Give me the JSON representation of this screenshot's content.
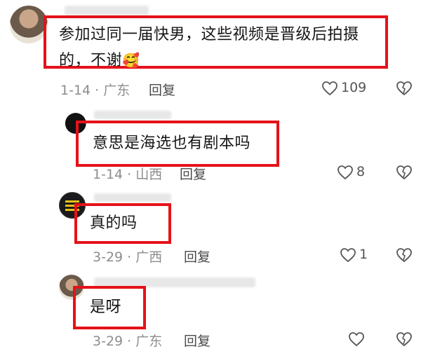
{
  "comments": [
    {
      "text_line1": "参加过同一届快男，这些视频是晋级后拍摄",
      "text_line2": "的，不谢",
      "emoji": "🥰",
      "meta": "1-14 · 广东",
      "reply_label": "回复",
      "like_count": "109"
    },
    {
      "text": "意思是海选也有剧本吗",
      "meta": "1-14 · 山西",
      "reply_label": "回复",
      "like_count": "8"
    },
    {
      "text": "真的吗",
      "meta": "3-29 · 广西",
      "reply_label": "回复",
      "like_count": "1"
    },
    {
      "text": "是呀",
      "meta": "3-29 · 广东",
      "reply_label": "回复",
      "like_count": ""
    }
  ],
  "colors": {
    "highlight_box": "#e5121a",
    "meta_gray": "#8d8d8d"
  },
  "icons": {
    "like": "heart-outline-icon",
    "dislike": "broken-heart-icon"
  }
}
